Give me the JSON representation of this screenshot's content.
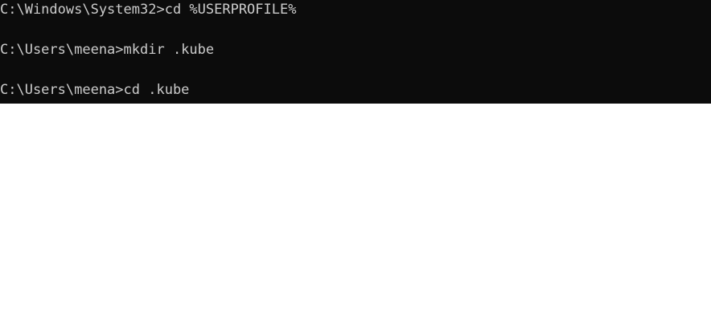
{
  "terminal": {
    "background": "#0c0c0c",
    "foreground": "#cccccc",
    "lines": [
      {
        "prompt": "C:\\Windows\\System32>",
        "command": "cd %USERPROFILE%"
      },
      {
        "prompt": "C:\\Users\\meena>",
        "command": "mkdir .kube"
      },
      {
        "prompt": "C:\\Users\\meena>",
        "command": "cd .kube"
      }
    ]
  }
}
